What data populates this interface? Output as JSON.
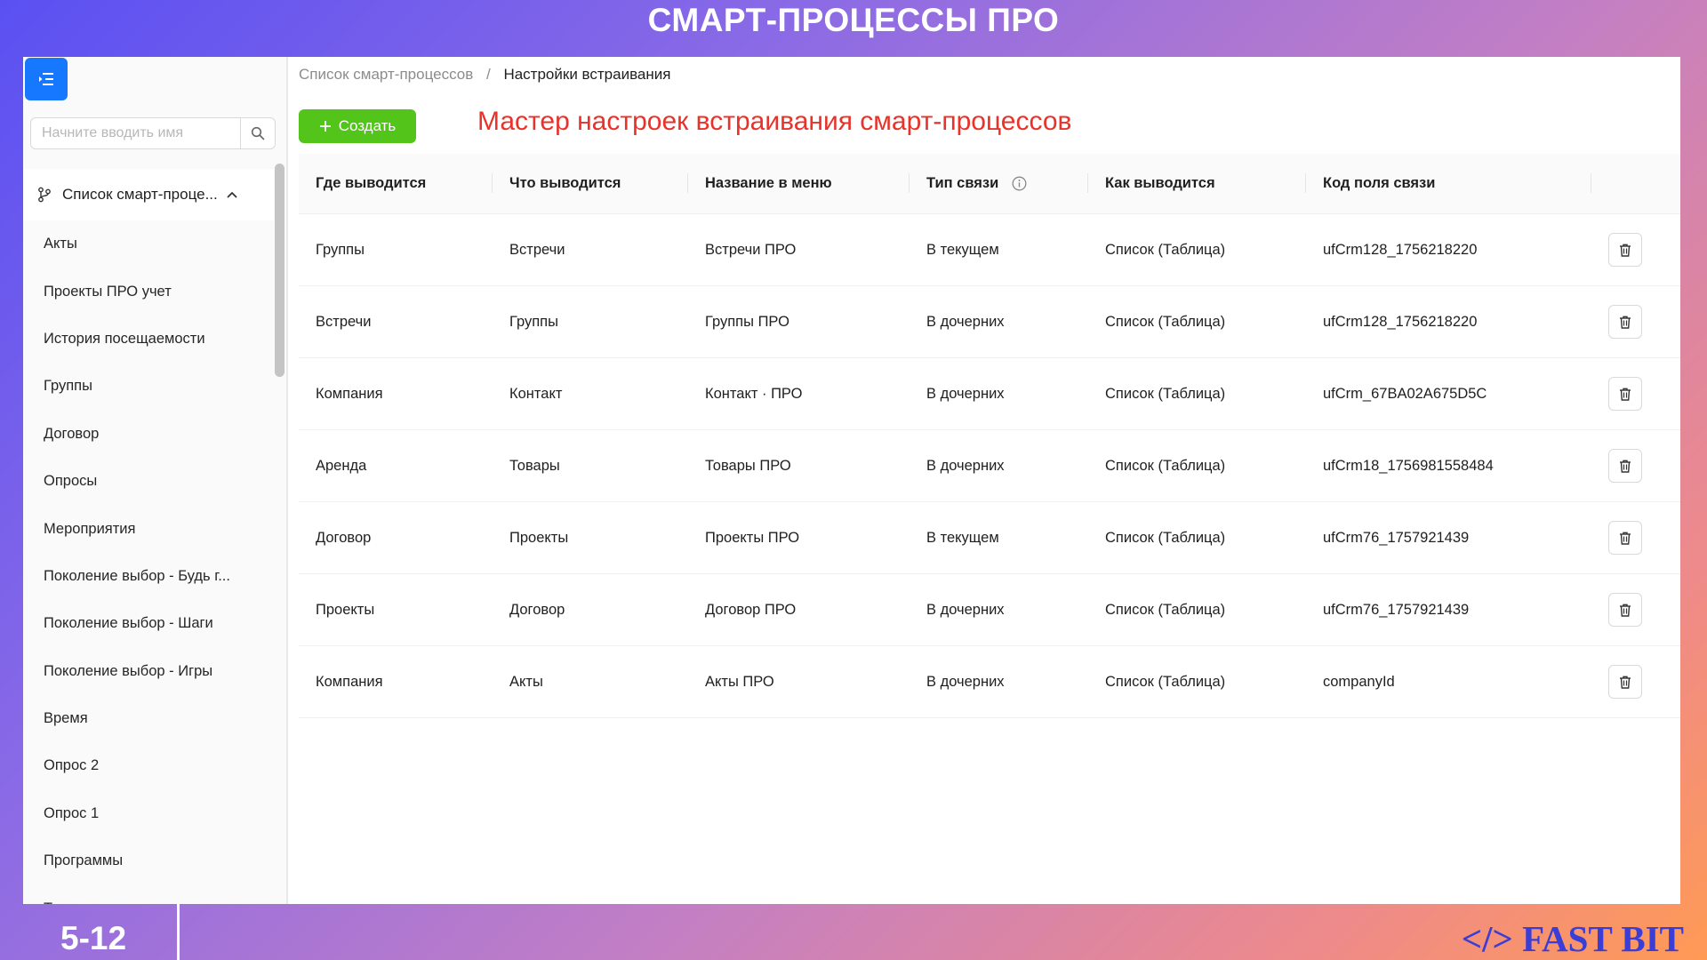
{
  "slide": {
    "title": "СМАРТ-ПРОЦЕССЫ ПРО",
    "page_number": "5-12",
    "brand": "</> FAST BIT",
    "note": "Мастер настроек встраивания смарт-процессов"
  },
  "colors": {
    "primary": "#1677ff",
    "create": "#52c41a",
    "note": "#e8322a",
    "brand": "#3a3dd6"
  },
  "sidebar": {
    "search_placeholder": "Начните вводить имя",
    "parent_label": "Список смарт-проце...",
    "items": [
      "Акты",
      "Проекты ПРО учет",
      "История посещаемости",
      "Группы",
      "Договор",
      "Опросы",
      "Мероприятия",
      "Поколение выбор - Будь г...",
      "Поколение выбор - Шаги",
      "Поколение выбор - Игры",
      "Время",
      "Опрос 2",
      "Опрос 1",
      "Программы",
      "Техника"
    ]
  },
  "breadcrumb": {
    "parent": "Список смарт-процессов",
    "separator": "/",
    "current": "Настройки встраивания"
  },
  "toolbar": {
    "create_label": "Создать"
  },
  "table": {
    "columns": [
      "Где выводится",
      "Что выводится",
      "Название в меню",
      "Тип связи",
      "Как выводится",
      "Код поля связи"
    ],
    "rows": [
      [
        "Группы",
        "Встречи",
        "Встречи ПРО",
        "В текущем",
        "Список (Таблица)",
        "ufCrm128_1756218220"
      ],
      [
        "Встречи",
        "Группы",
        "Группы ПРО",
        "В дочерних",
        "Список (Таблица)",
        "ufCrm128_1756218220"
      ],
      [
        "Компания",
        "Контакт",
        "Контакт · ПРО",
        "В дочерних",
        "Список (Таблица)",
        "ufCrm_67BA02A675D5C"
      ],
      [
        "Аренда",
        "Товары",
        "Товары ПРО",
        "В дочерних",
        "Список (Таблица)",
        "ufCrm18_1756981558484"
      ],
      [
        "Договор",
        "Проекты",
        "Проекты ПРО",
        "В текущем",
        "Список (Таблица)",
        "ufCrm76_1757921439"
      ],
      [
        "Проекты",
        "Договор",
        "Договор ПРО",
        "В дочерних",
        "Список (Таблица)",
        "ufCrm76_1757921439"
      ],
      [
        "Компания",
        "Акты",
        "Акты ПРО",
        "В дочерних",
        "Список (Таблица)",
        "companyId"
      ]
    ]
  }
}
